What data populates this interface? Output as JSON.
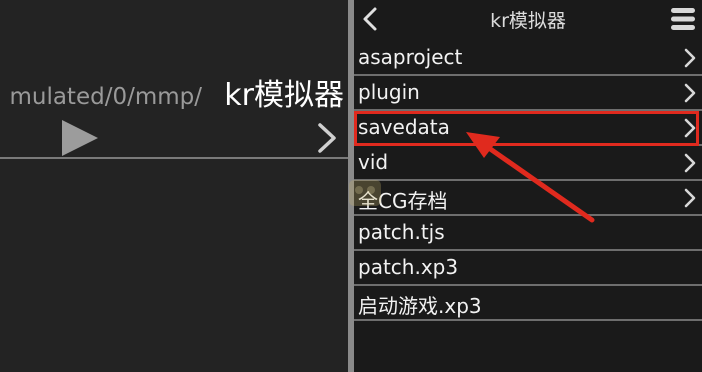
{
  "left_pane": {
    "path_prefix": "mulated/0/mmp/",
    "path_current": "kr模拟器"
  },
  "right_pane": {
    "title": "kr模拟器",
    "items": [
      {
        "label": "asaproject",
        "is_folder": true
      },
      {
        "label": "plugin",
        "is_folder": true
      },
      {
        "label": "savedata",
        "is_folder": true,
        "highlighted": true
      },
      {
        "label": "vid",
        "is_folder": true
      },
      {
        "label": "全CG存档",
        "is_folder": true
      },
      {
        "label": "patch.tjs",
        "is_folder": false
      },
      {
        "label": "patch.xp3",
        "is_folder": false
      },
      {
        "label": "启动游戏.xp3",
        "is_folder": false
      }
    ]
  },
  "colors": {
    "highlight": "#e02a1e",
    "background": "#1a1a1a",
    "text": "#f2f2f2"
  },
  "icons": {
    "back": "chevron-left-icon",
    "menu": "hamburger-menu-icon",
    "play": "play-icon",
    "folder_chevron": "chevron-right-icon"
  }
}
